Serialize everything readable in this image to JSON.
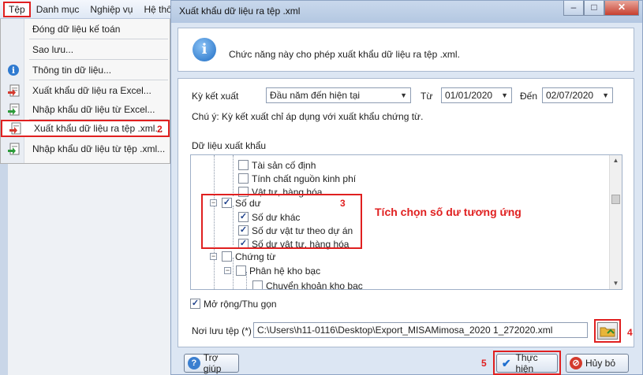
{
  "menubar": {
    "items": [
      {
        "label": "Tệp"
      },
      {
        "label": "Danh mục"
      },
      {
        "label": "Nghiệp vụ"
      },
      {
        "label": "Hệ thốr"
      }
    ]
  },
  "file_menu": {
    "items": [
      {
        "label": "Đóng dữ liệu kế toán",
        "icon": "none"
      },
      {
        "label": "Sao lưu...",
        "icon": "none"
      },
      {
        "label": "Thông tin dữ liệu...",
        "icon": "info-icon"
      },
      {
        "label": "Xuất khẩu dữ liệu ra Excel...",
        "icon": "excel-export-icon"
      },
      {
        "label": "Nhập khẩu dữ liệu từ Excel...",
        "icon": "excel-import-icon"
      },
      {
        "label": "Xuất khẩu dữ liệu ra tệp .xml...",
        "icon": "xml-export-icon"
      },
      {
        "label": "Nhập khẩu dữ liệu từ tệp .xml...",
        "icon": "xml-import-icon"
      }
    ]
  },
  "annotations": {
    "step1": "1",
    "step2": "2",
    "step3": "3",
    "step4": "4",
    "step5": "5",
    "note": "Tích chọn số dư tương ứng"
  },
  "dialog": {
    "title": "Xuất khẩu dữ liệu ra tệp .xml",
    "info_text": "Chức năng này cho phép xuất khẩu dữ liệu ra tệp .xml.",
    "period_label": "Kỳ kết xuất",
    "period_value": "Đầu năm đến hiện tại",
    "from_label": "Từ",
    "from_value": "01/01/2020",
    "to_label": "Đến",
    "to_value": "02/07/2020",
    "note": "Chú ý: Kỳ kết xuất chỉ áp dụng với xuất khẩu chứng từ.",
    "export_data_label": "Dữ liệu xuất khẩu",
    "tree": [
      {
        "label": "Tài sản cố định",
        "checked": false
      },
      {
        "label": "Tính chất nguồn kinh phí",
        "checked": false
      },
      {
        "label": "Vật tư, hàng hóa",
        "checked": false
      },
      {
        "label": "Số dư",
        "checked": true
      },
      {
        "label": "Số dư khác",
        "checked": true
      },
      {
        "label": "Số dư vật tư theo dự án",
        "checked": true
      },
      {
        "label": "Số dư vật tư, hàng hóa",
        "checked": true
      },
      {
        "label": "Chứng từ",
        "checked": false
      },
      {
        "label": "Phân hệ kho bạc",
        "checked": false
      },
      {
        "label": "Chuyển khoản kho bạc",
        "checked": false
      }
    ],
    "expand_label": "Mở rộng/Thu gọn",
    "expand_checked": true,
    "save_path_label": "Nơi lưu tệp (*)",
    "save_path_value": "C:\\Users\\h11-0116\\Desktop\\Export_MISAMimosa_2020 1_272020.xml",
    "help_label": "Trợ giúp",
    "execute_label": "Thực hiện",
    "cancel_label": "Hủy bỏ"
  }
}
